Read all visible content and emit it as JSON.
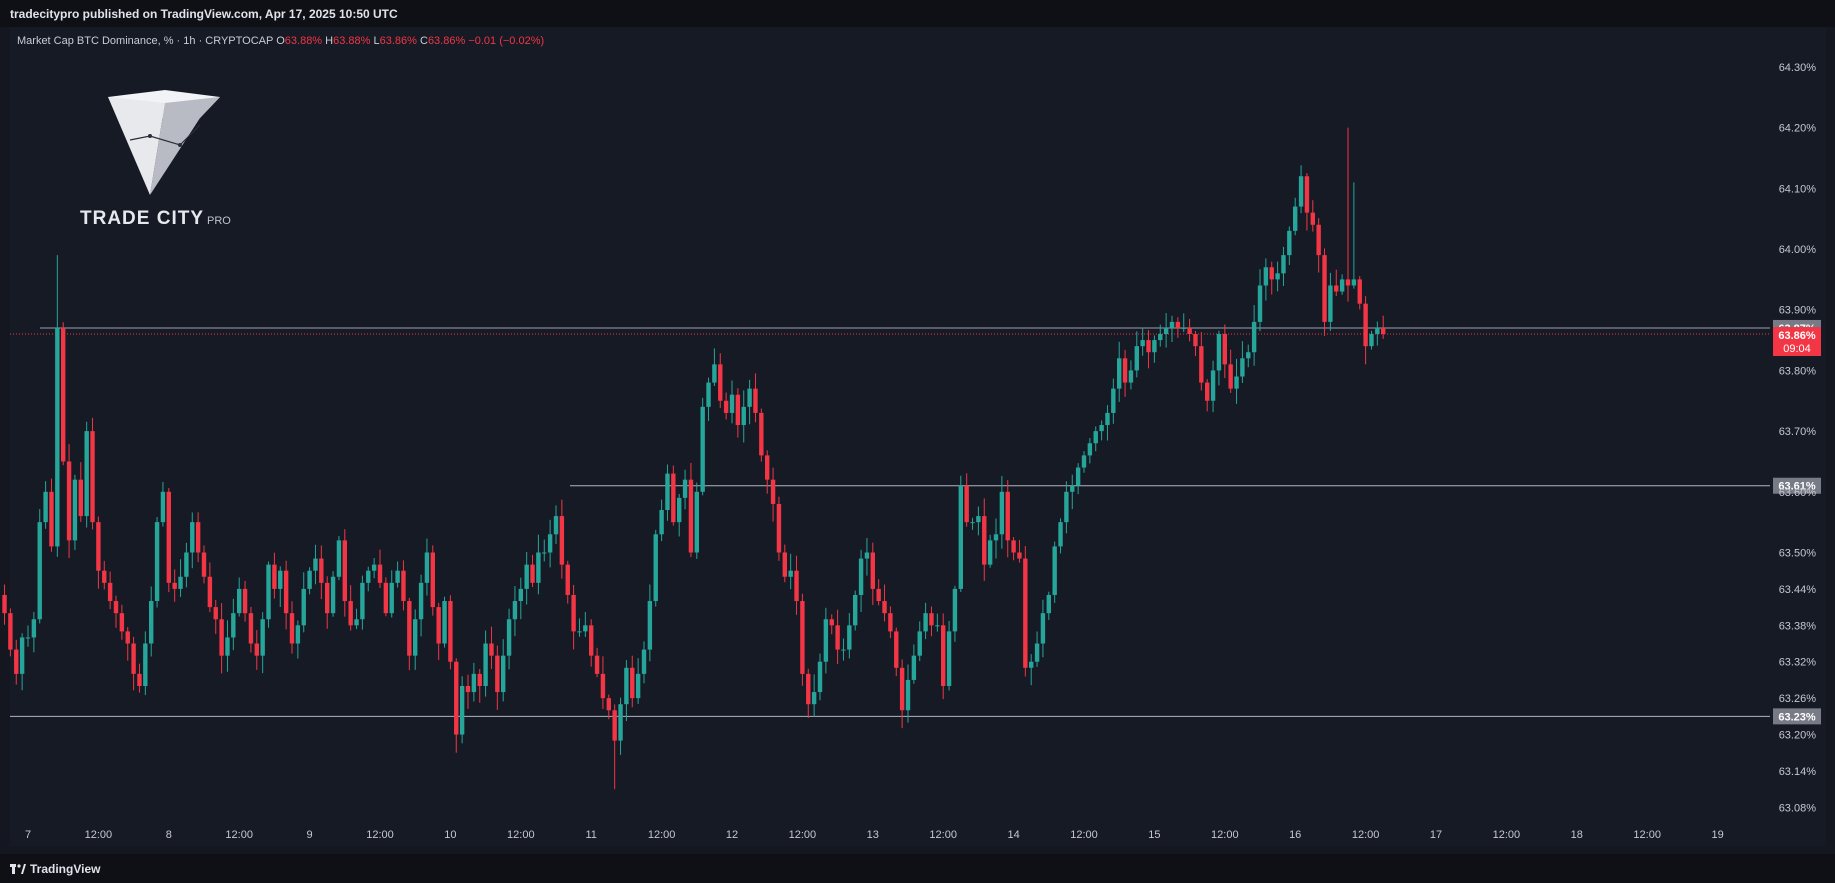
{
  "header": {
    "published": "tradecitypro published on TradingView.com, Apr 17, 2025 10:50 UTC"
  },
  "legend": {
    "symbol": "Market Cap BTC Dominance, % · 1h · CRYPTOCAP",
    "o_label": "O",
    "o": "63.88%",
    "h_label": "H",
    "h": "63.88%",
    "l_label": "L",
    "l": "63.86%",
    "c_label": "C",
    "c": "63.86%",
    "change": "−0.01 (−0.02%)"
  },
  "brand": {
    "name": "TRADE CITY",
    "suffix": "PRO"
  },
  "footer": {
    "logo_text": "TradingView"
  },
  "colors": {
    "up": "#26a69a",
    "down": "#f23645",
    "bg": "#161a25",
    "label_gray": "#787b86",
    "line": "#b2b5be"
  },
  "chart_data": {
    "type": "candlestick",
    "title": "",
    "ylabel": "",
    "xlabel": "",
    "ylim": [
      63.03,
      64.33
    ],
    "y_ticks": [
      "64.30%",
      "64.20%",
      "64.10%",
      "64.00%",
      "63.90%",
      "63.80%",
      "63.70%",
      "63.60%",
      "63.50%",
      "63.44%",
      "63.38%",
      "63.32%",
      "63.26%",
      "63.20%",
      "63.14%",
      "63.08%"
    ],
    "x_ticks": [
      "7",
      "12:00",
      "8",
      "12:00",
      "9",
      "12:00",
      "10",
      "12:00",
      "11",
      "12:00",
      "12",
      "12:00",
      "13",
      "12:00",
      "14",
      "12:00",
      "15",
      "12:00",
      "16",
      "12:00",
      "17",
      "12:00",
      "18",
      "12:00",
      "19"
    ],
    "y_tick_values": [
      64.3,
      64.2,
      64.1,
      64.0,
      63.9,
      63.8,
      63.7,
      63.6,
      63.5,
      63.44,
      63.38,
      63.32,
      63.26,
      63.2,
      63.14,
      63.08
    ],
    "x_range": [
      "Apr 7 00:00",
      "Apr 19 12:00"
    ],
    "candle_start": "Apr 6 20:00",
    "interval": "1h",
    "grid": false,
    "horizontal_lines": [
      {
        "value": 63.87,
        "label": "63.87%"
      },
      {
        "value": 63.61,
        "label": "63.61%"
      },
      {
        "value": 63.23,
        "label": "63.23%"
      }
    ],
    "price_label": {
      "value": "63.86%",
      "countdown": "09:04"
    },
    "closes": [
      63.4,
      63.34,
      63.3,
      63.36,
      63.36,
      63.39,
      63.55,
      63.6,
      63.51,
      63.87,
      63.65,
      63.52,
      63.62,
      63.56,
      63.7,
      63.55,
      63.47,
      63.45,
      63.42,
      63.4,
      63.37,
      63.35,
      63.3,
      63.28,
      63.35,
      63.42,
      63.55,
      63.6,
      63.45,
      63.44,
      63.46,
      63.5,
      63.55,
      63.5,
      63.46,
      63.41,
      63.39,
      63.33,
      63.36,
      63.4,
      63.44,
      63.4,
      63.35,
      63.33,
      63.39,
      63.48,
      63.44,
      63.47,
      63.4,
      63.35,
      63.38,
      63.44,
      63.47,
      63.49,
      63.45,
      63.4,
      63.46,
      63.52,
      63.42,
      63.38,
      63.39,
      63.45,
      63.47,
      63.48,
      63.45,
      63.4,
      63.45,
      63.47,
      63.42,
      63.33,
      63.39,
      63.45,
      63.5,
      63.41,
      63.35,
      63.42,
      63.32,
      63.2,
      63.28,
      63.27,
      63.3,
      63.28,
      63.35,
      63.33,
      63.27,
      63.33,
      63.39,
      63.42,
      63.44,
      63.48,
      63.45,
      63.5,
      63.5,
      63.53,
      63.56,
      63.48,
      63.43,
      63.37,
      63.37,
      63.38,
      63.33,
      63.3,
      63.26,
      63.24,
      63.19,
      63.25,
      63.31,
      63.26,
      63.3,
      63.34,
      63.42,
      63.53,
      63.57,
      63.63,
      63.55,
      63.59,
      63.62,
      63.5,
      63.6,
      63.74,
      63.78,
      63.81,
      63.75,
      63.73,
      63.76,
      63.71,
      63.74,
      63.77,
      63.73,
      63.66,
      63.62,
      63.58,
      63.5,
      63.46,
      63.47,
      63.42,
      63.3,
      63.25,
      63.27,
      63.32,
      63.39,
      63.38,
      63.34,
      63.34,
      63.38,
      63.43,
      63.49,
      63.5,
      63.44,
      63.42,
      63.4,
      63.37,
      63.31,
      63.24,
      63.29,
      63.33,
      63.37,
      63.4,
      63.38,
      63.38,
      63.28,
      63.37,
      63.44,
      63.61,
      63.55,
      63.55,
      63.56,
      63.48,
      63.52,
      63.53,
      63.6,
      63.52,
      63.5,
      63.49,
      63.31,
      63.32,
      63.35,
      63.4,
      63.43,
      63.51,
      63.55,
      63.6,
      63.61,
      63.64,
      63.66,
      63.68,
      63.7,
      63.71,
      63.73,
      63.77,
      63.82,
      63.78,
      63.8,
      63.84,
      63.85,
      63.83,
      63.85,
      63.86,
      63.87,
      63.88,
      63.87,
      63.87,
      63.86,
      63.84,
      63.78,
      63.75,
      63.8,
      63.86,
      63.81,
      63.77,
      63.79,
      63.82,
      63.83,
      63.88,
      63.94,
      63.97,
      63.95,
      63.96,
      63.99,
      64.03,
      64.07,
      64.12,
      64.06,
      64.04,
      63.99,
      63.88,
      63.94,
      63.93,
      63.95,
      63.94,
      63.95,
      63.91,
      63.84,
      63.86,
      63.87,
      63.86
    ]
  }
}
